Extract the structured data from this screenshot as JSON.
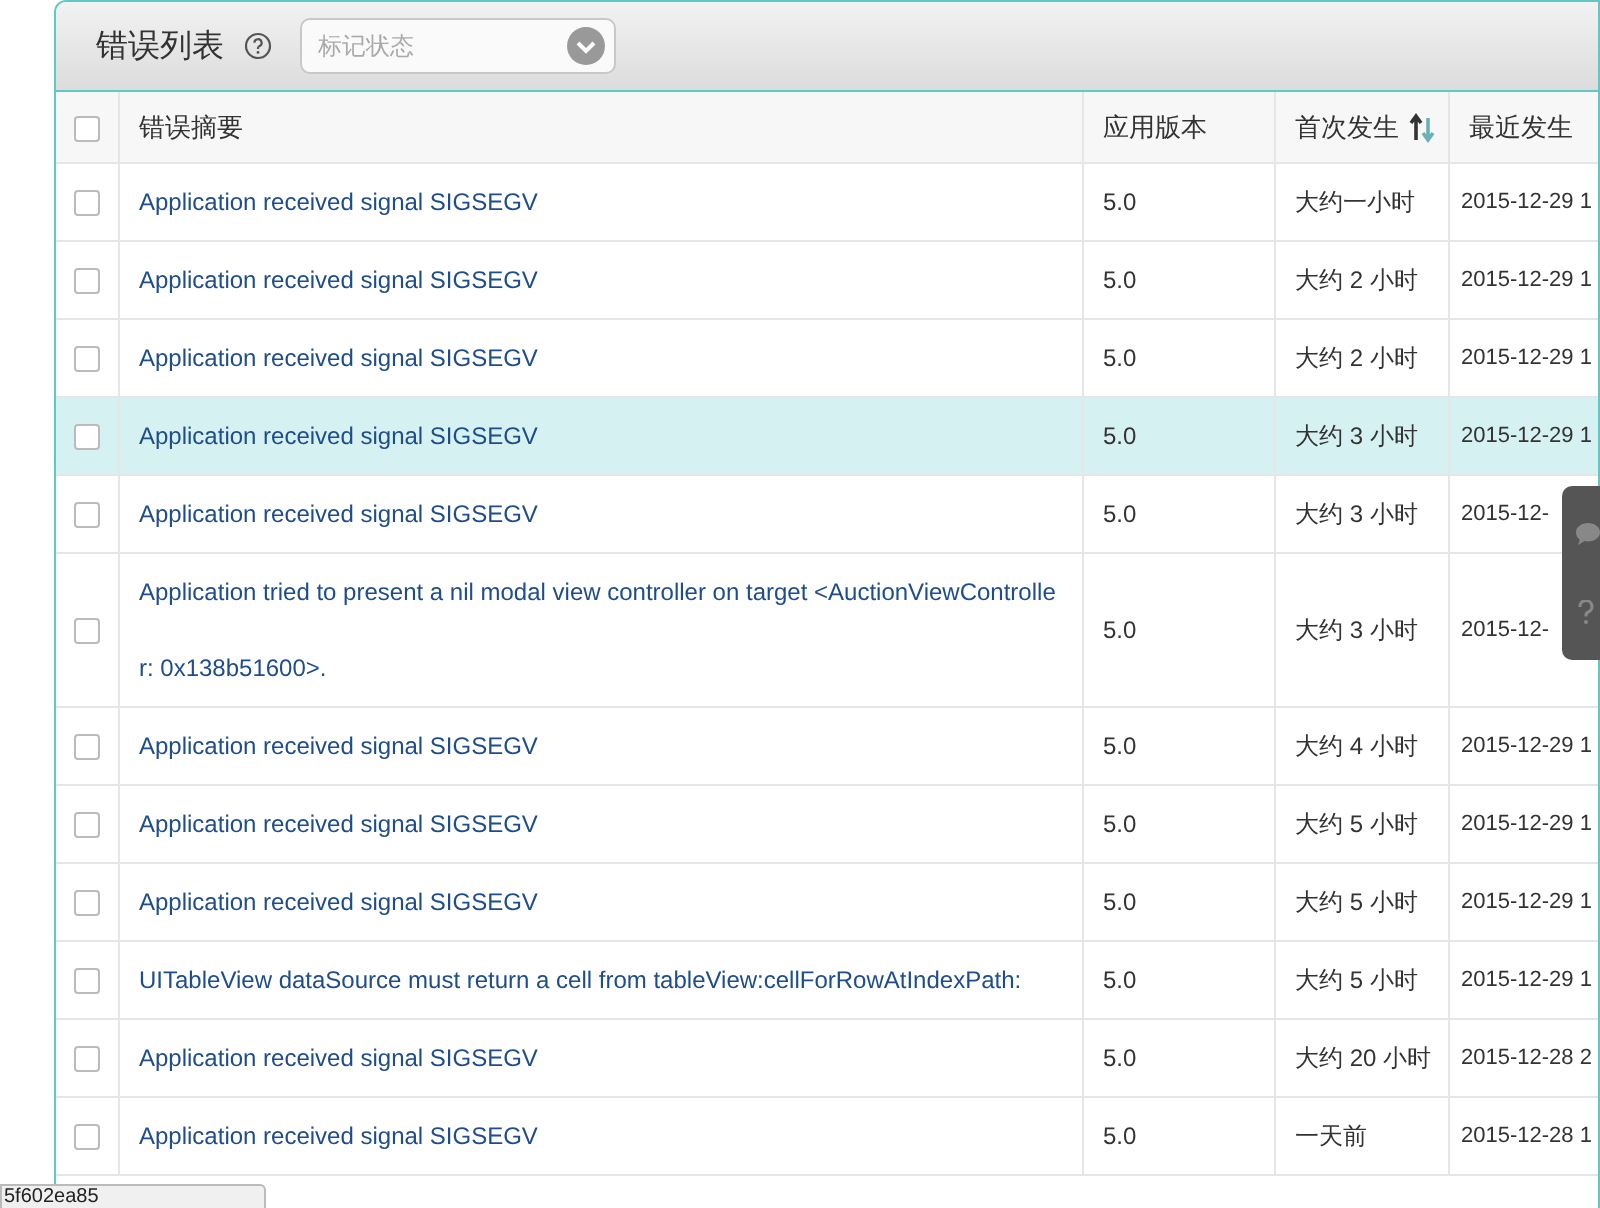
{
  "panel": {
    "title": "错误列表",
    "filter": {
      "placeholder": "标记状态"
    }
  },
  "table": {
    "columns": [
      {
        "label": "错误摘要",
        "sorted": false
      },
      {
        "label": "应用版本",
        "sorted": false
      },
      {
        "label": "首次发生",
        "sorted": true
      },
      {
        "label": "最近发生",
        "sorted": false
      }
    ],
    "header_checked": false,
    "rows": [
      {
        "checked": false,
        "selected": false,
        "summary": "Application received signal SIGSEGV",
        "version": "5.0",
        "first": "大约一小时",
        "recent": "2015-12-29 1"
      },
      {
        "checked": false,
        "selected": false,
        "summary": "Application received signal SIGSEGV",
        "version": "5.0",
        "first": "大约 2 小时",
        "recent": "2015-12-29 1"
      },
      {
        "checked": false,
        "selected": false,
        "summary": "Application received signal SIGSEGV",
        "version": "5.0",
        "first": "大约 2 小时",
        "recent": "2015-12-29 1"
      },
      {
        "checked": false,
        "selected": true,
        "summary": "Application received signal SIGSEGV",
        "version": "5.0",
        "first": "大约 3 小时",
        "recent": "2015-12-29 1"
      },
      {
        "checked": false,
        "selected": false,
        "summary": "Application received signal SIGSEGV",
        "version": "5.0",
        "first": "大约 3 小时",
        "recent": "2015-12-"
      },
      {
        "checked": false,
        "selected": false,
        "summary": "Application tried to present a nil modal view controller on target <AuctionViewController: 0x138b51600>.",
        "version": "5.0",
        "first": "大约 3 小时",
        "recent": "2015-12-"
      },
      {
        "checked": false,
        "selected": false,
        "summary": "Application received signal SIGSEGV",
        "version": "5.0",
        "first": "大约 4 小时",
        "recent": "2015-12-29 1"
      },
      {
        "checked": false,
        "selected": false,
        "summary": "Application received signal SIGSEGV",
        "version": "5.0",
        "first": "大约 5 小时",
        "recent": "2015-12-29 1"
      },
      {
        "checked": false,
        "selected": false,
        "summary": "Application received signal SIGSEGV",
        "version": "5.0",
        "first": "大约 5 小时",
        "recent": "2015-12-29 1"
      },
      {
        "checked": false,
        "selected": false,
        "summary": "UITableView dataSource must return a cell from tableView:cellForRowAtIndexPath:",
        "version": "5.0",
        "first": "大约 5 小时",
        "recent": "2015-12-29 1"
      },
      {
        "checked": false,
        "selected": false,
        "summary": "Application received signal SIGSEGV",
        "version": "5.0",
        "first": "大约 20 小时",
        "recent": "2015-12-28 2"
      },
      {
        "checked": false,
        "selected": false,
        "summary": "Application received signal SIGSEGV",
        "version": "5.0",
        "first": "一天前",
        "recent": "2015-12-28 1"
      }
    ]
  },
  "status_url": "5f602ea85"
}
